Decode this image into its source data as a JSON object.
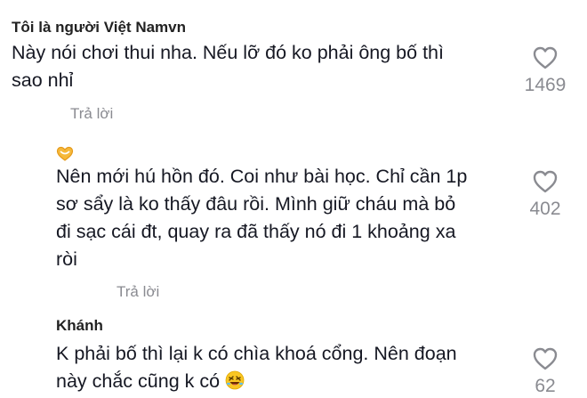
{
  "comments": [
    {
      "username": "Tôi là người Việt Namvn",
      "text_line1": "Này nói chơi thui nha. Nếu lỡ đó ko phải ông bố thì",
      "text_line2": "sao nhỉ",
      "likes": "1469",
      "reply_label": "Trả lời"
    },
    {
      "username_emoji": "heart-hands-emoji",
      "text_line1": "Nên mới hú hồn đó. Coi như bài học. Chỉ cần 1p",
      "text_line2": "sơ sẩy là ko thấy đâu rồi. Mình giữ cháu mà bỏ",
      "text_line3": "đi sạc cái đt, quay ra đã thấy nó đi 1 khoảng xa",
      "text_line4": "ròi",
      "likes": "402",
      "reply_label": "Trả lời"
    },
    {
      "username": "Khánh",
      "text_line1": "K phải bố thì lại k có chìa khoá cổng. Nên đoạn",
      "text_line2": "này chắc cũng k có",
      "trailing_emoji": "rofl-emoji",
      "likes": "62"
    }
  ],
  "colors": {
    "text": "#161823",
    "muted": "#8a8b91",
    "icon": "#8a8b91"
  }
}
